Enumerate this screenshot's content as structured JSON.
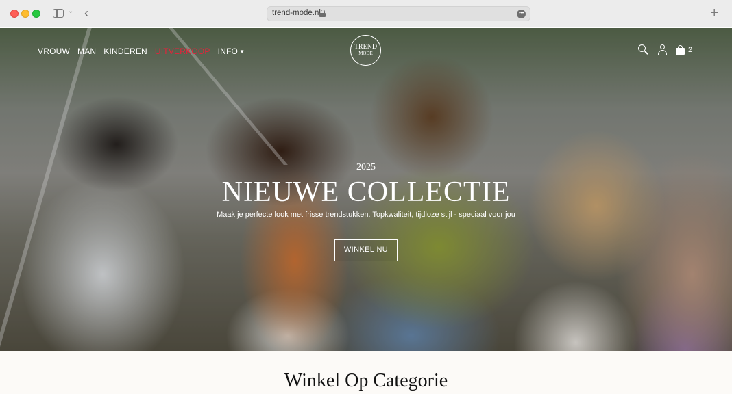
{
  "browser": {
    "url": "trend-mode.nl",
    "new_tab_label": "+"
  },
  "nav": {
    "items": [
      {
        "label": "VROUW",
        "active": true
      },
      {
        "label": "MAN"
      },
      {
        "label": "KINDEREN"
      },
      {
        "label": "UITVERKOOP",
        "color": "#e8213a"
      },
      {
        "label": "INFO",
        "has_dropdown": true
      }
    ]
  },
  "logo": {
    "line1": "TREND",
    "line2": "MODE"
  },
  "cart": {
    "count": "2"
  },
  "hero": {
    "year": "2025",
    "title": "NIEUWE COLLECTIE",
    "subtitle": "Maak je perfecte look met frisse trendstukken. Topkwaliteit, tijdloze stijl - speciaal voor jou",
    "cta_label": "WINKEL NU"
  },
  "section": {
    "title": "Winkel Op Categorie"
  },
  "colors": {
    "accent_sale": "#e8213a",
    "hero_text": "#ffffff",
    "section_bg": "#fcfaf7"
  },
  "icons": [
    "search-icon",
    "account-icon",
    "bag-icon",
    "lock-icon",
    "more-icon",
    "back-icon",
    "sidebar-icon"
  ]
}
